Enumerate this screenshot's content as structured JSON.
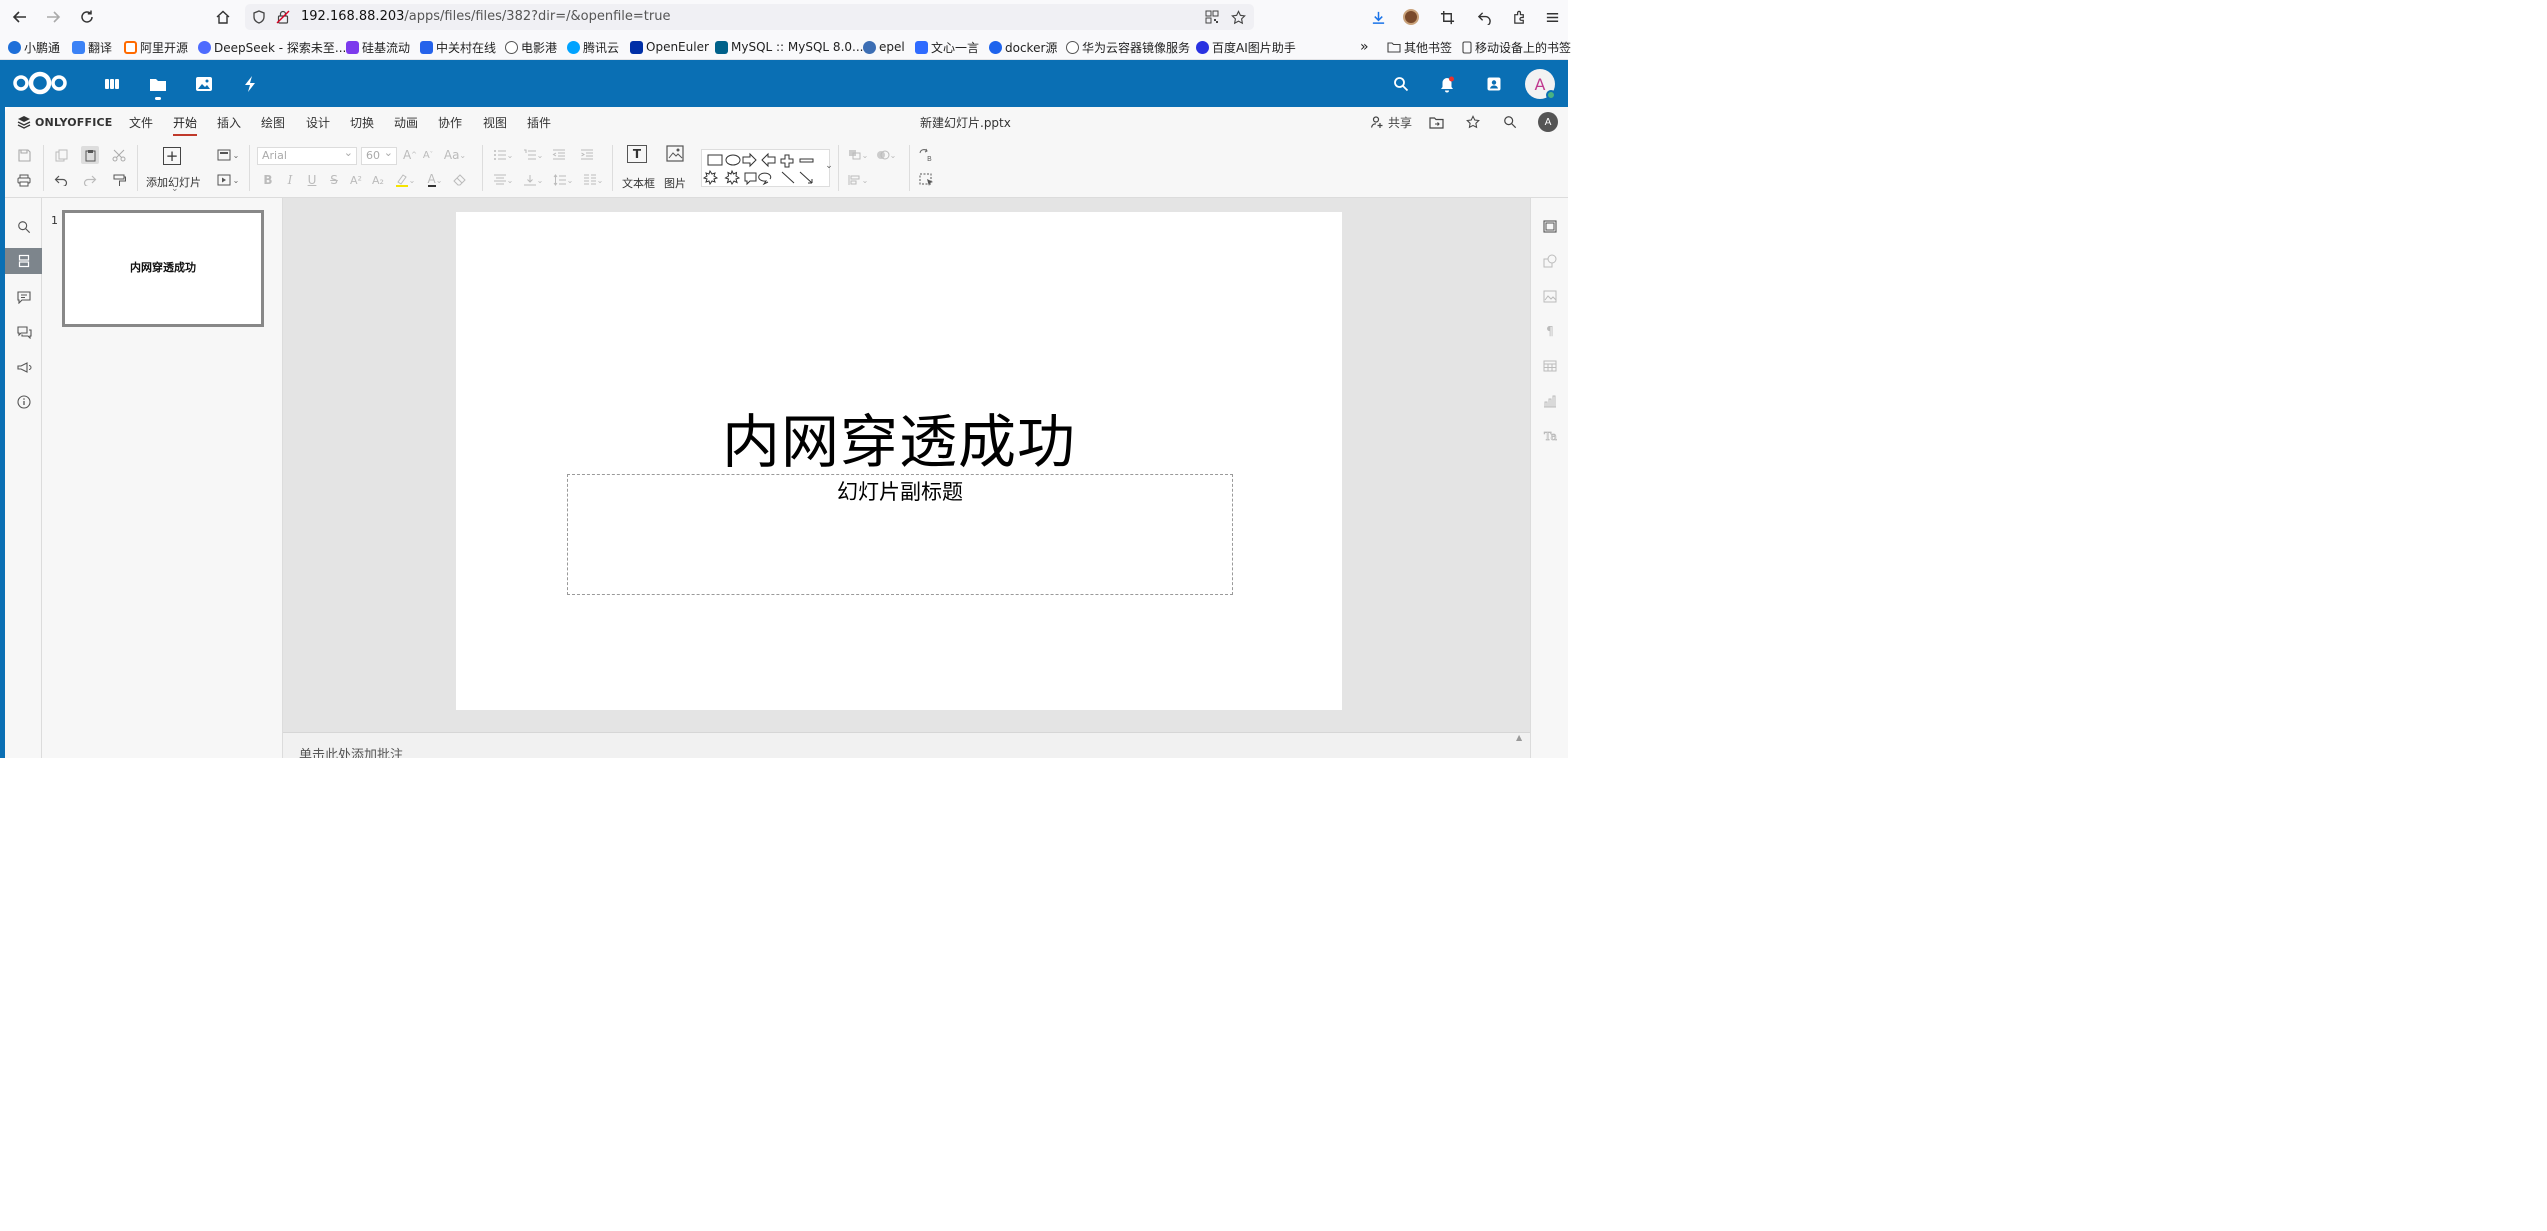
{
  "browser": {
    "url_host": "192.168.88.203",
    "url_path": "/apps/files/files/382?dir=/&openfile=true"
  },
  "bookmarks": [
    {
      "label": "小鹏通",
      "color": "#1e6fd9"
    },
    {
      "label": "翻译",
      "color": "#3b82f6"
    },
    {
      "label": "阿里开源",
      "color": "#ff6a00"
    },
    {
      "label": "DeepSeek - 探索未至...",
      "color": "#4d6bfe"
    },
    {
      "label": "硅基流动",
      "color": "#7c3aed"
    },
    {
      "label": "中关村在线",
      "color": "#2563eb"
    },
    {
      "label": "电影港",
      "color": "#555555"
    },
    {
      "label": "腾讯云",
      "color": "#00a3ff"
    },
    {
      "label": "OpenEuler",
      "color": "#002fa7"
    },
    {
      "label": "MySQL :: MySQL 8.0...",
      "color": "#00618a"
    },
    {
      "label": "epel",
      "color": "#3c6eb4"
    },
    {
      "label": "文心一言",
      "color": "#2f6bff"
    },
    {
      "label": "docker源",
      "color": "#1d63ed"
    },
    {
      "label": "华为云容器镜像服务",
      "color": "#555555"
    },
    {
      "label": "百度AI图片助手",
      "color": "#2932e1"
    }
  ],
  "bookmarks_right": {
    "more": "»",
    "other": "其他书签",
    "mobile": "移动设备上的书签"
  },
  "nextcloud": {
    "avatar_letter": "A",
    "colors": {
      "header": "#0a6fb4",
      "status": "#49b382"
    }
  },
  "onlyoffice": {
    "logo": "ONLYOFFICE",
    "menu_tabs": [
      "文件",
      "开始",
      "插入",
      "绘图",
      "设计",
      "切换",
      "动画",
      "协作",
      "视图",
      "插件"
    ],
    "active_tab": "开始",
    "document_title": "新建幻灯片.pptx",
    "share_label": "共享",
    "user_initial": "A",
    "toolbar": {
      "add_slide": "添加幻灯片",
      "font_name": "Arial",
      "font_size": "60",
      "text_box": "文本框",
      "picture": "图片"
    }
  },
  "slides": {
    "thumbnail_number": "1",
    "thumbnail_text": "内网穿透成功"
  },
  "slide": {
    "title": "内网穿透成功",
    "subtitle": "幻灯片副标题"
  },
  "notes": {
    "placeholder": "单击此处添加批注"
  }
}
